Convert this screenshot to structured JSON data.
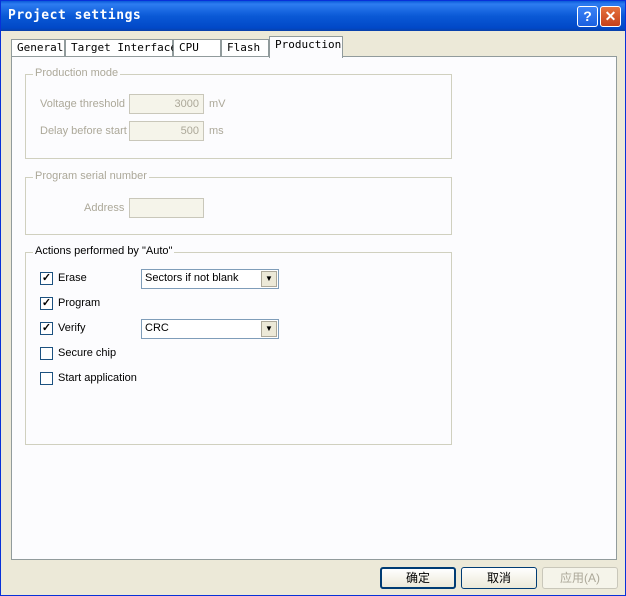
{
  "window": {
    "title": "Project settings"
  },
  "tabs": [
    "General",
    "Target Interface",
    "CPU",
    "Flash",
    "Production"
  ],
  "production_mode": {
    "title": "Production mode",
    "voltage_label": "Voltage threshold",
    "voltage_value": "3000",
    "voltage_unit": "mV",
    "delay_label": "Delay before start",
    "delay_value": "500",
    "delay_unit": "ms"
  },
  "serial": {
    "title": "Program serial number",
    "address_label": "Address",
    "address_value": ""
  },
  "auto_actions": {
    "title": "Actions performed by \"Auto\"",
    "erase": {
      "label": "Erase",
      "checked": true,
      "option": "Sectors if not blank"
    },
    "program": {
      "label": "Program",
      "checked": true
    },
    "verify": {
      "label": "Verify",
      "checked": true,
      "option": "CRC"
    },
    "secure": {
      "label": "Secure chip",
      "checked": false
    },
    "start": {
      "label": "Start application",
      "checked": false
    }
  },
  "buttons": {
    "ok": "确定",
    "cancel": "取消",
    "apply": "应用(A)"
  },
  "icons": {
    "help": "help-icon",
    "close": "close-icon",
    "check": "checkmark-icon",
    "dropdown": "chevron-down-icon"
  }
}
